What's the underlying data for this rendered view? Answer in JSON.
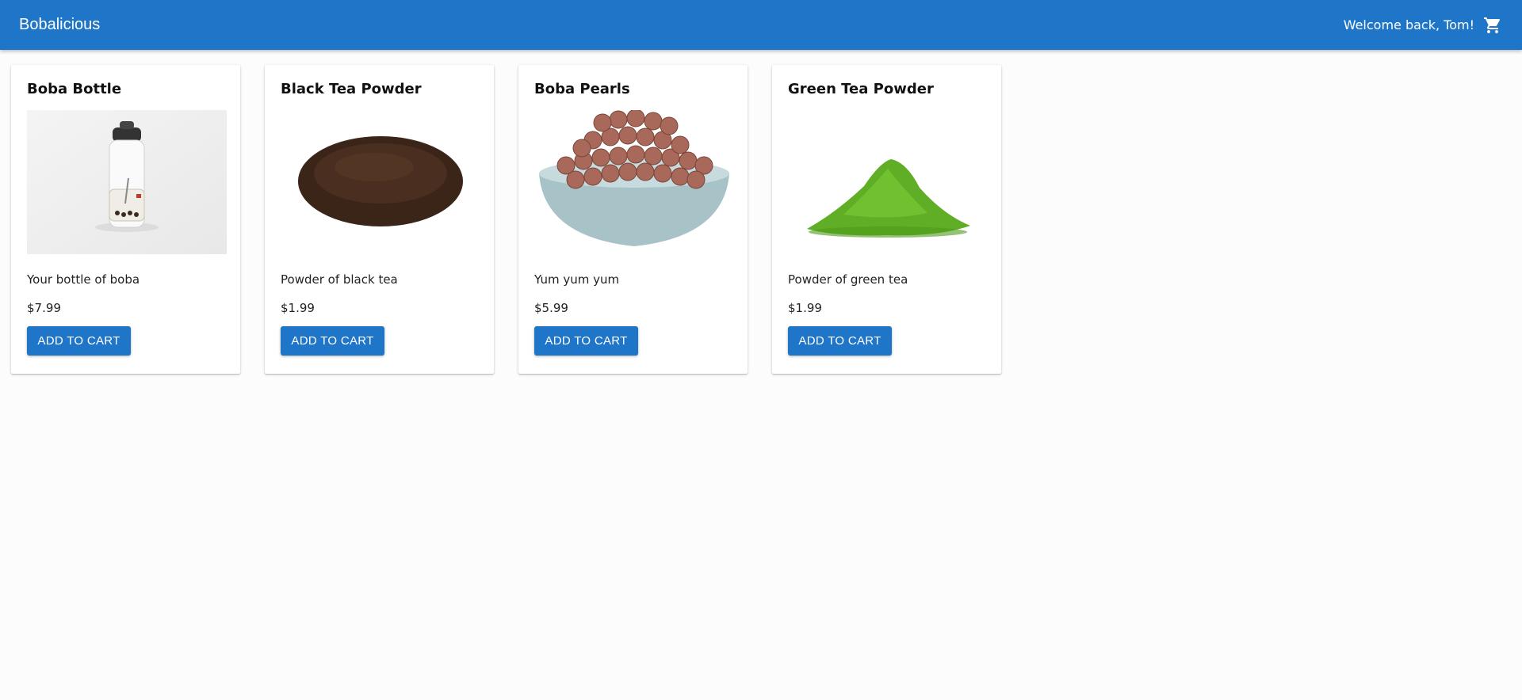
{
  "header": {
    "brand": "Bobalicious",
    "welcome": "Welcome back, Tom!",
    "cart_icon": "shopping-cart-icon"
  },
  "colors": {
    "appbar": "#1f76c8",
    "button": "#1f76c8",
    "background": "#fcfcfc"
  },
  "products": [
    {
      "title": "Boba Bottle",
      "image": "boba-bottle-image",
      "description": "Your bottle of boba",
      "price": "$7.99",
      "button": "ADD TO CART"
    },
    {
      "title": "Black Tea Powder",
      "image": "black-tea-powder-image",
      "description": "Powder of black tea",
      "price": "$1.99",
      "button": "ADD TO CART"
    },
    {
      "title": "Boba Pearls",
      "image": "boba-pearls-image",
      "description": "Yum yum yum",
      "price": "$5.99",
      "button": "ADD TO CART"
    },
    {
      "title": "Green Tea Powder",
      "image": "green-tea-powder-image",
      "description": "Powder of green tea",
      "price": "$1.99",
      "button": "ADD TO CART"
    }
  ]
}
